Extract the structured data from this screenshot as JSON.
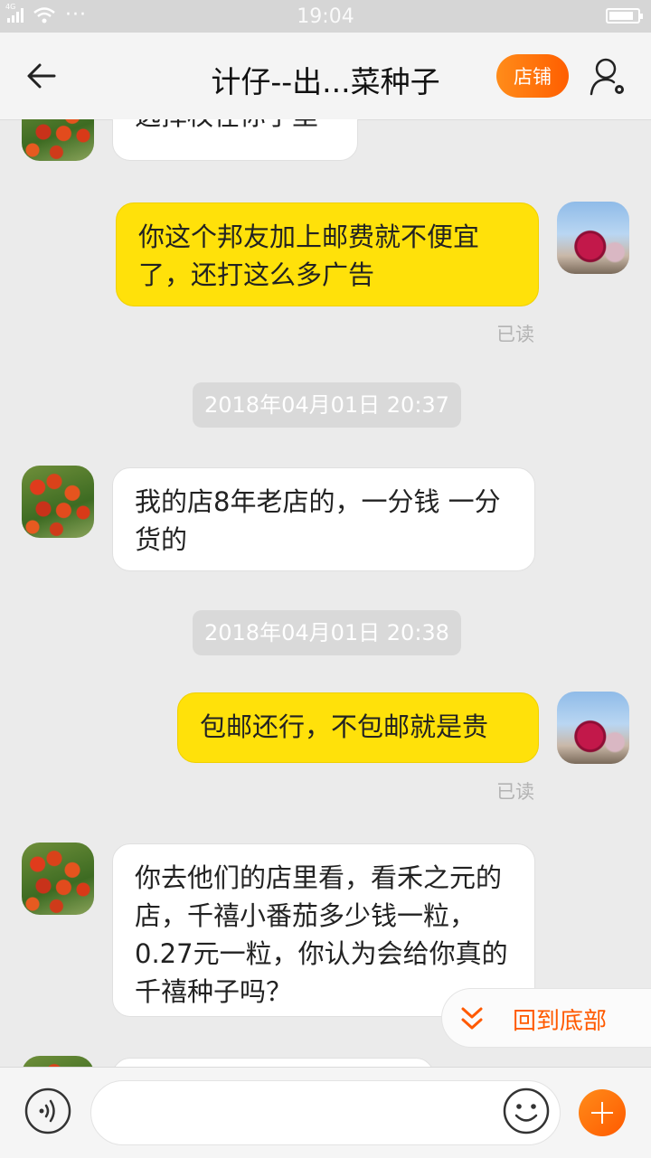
{
  "status_bar": {
    "time": "19:04",
    "network": "4G",
    "more": "···"
  },
  "header": {
    "title": "计仔--出...菜种子",
    "shop_button": "店铺",
    "icons": {
      "back": "back-arrow-icon",
      "user": "user-settings-icon"
    }
  },
  "messages": [
    {
      "side": "in",
      "text": "选择权在你手里"
    },
    {
      "side": "out",
      "text": "你这个邦友加上邮费就不便宜了，还打这么多广告",
      "status": "已读"
    },
    {
      "type": "time",
      "text": "2018年04月01日 20:37"
    },
    {
      "side": "in",
      "text": "我的店8年老店的，一分钱 一分货的"
    },
    {
      "type": "time",
      "text": "2018年04月01日 20:38"
    },
    {
      "side": "out",
      "text": "包邮还行，不包邮就是贵",
      "status": "已读"
    },
    {
      "side": "in",
      "text": "你去他们的店里看，看禾之元的店，千禧小番茄多少钱一粒，0.27元一粒，你认为会给你真的千禧种子吗？"
    }
  ],
  "jump_to_bottom": {
    "label": "回到底部",
    "icon": "double-chevron-down-icon"
  },
  "input_bar": {
    "placeholder": "",
    "icons": {
      "voice": "voice-icon",
      "emoji": "emoji-icon",
      "plus": "plus-icon"
    }
  },
  "colors": {
    "accent": "#ff6a00",
    "out_bubble": "#ffe10a",
    "background": "#ebebeb"
  }
}
